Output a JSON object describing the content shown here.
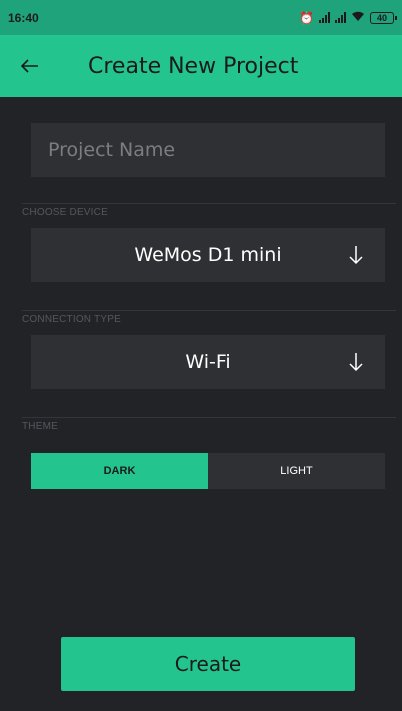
{
  "status_bar": {
    "time": "16:40",
    "battery": "40"
  },
  "app_bar": {
    "title": "Create New Project",
    "back_icon": "arrow-left-icon"
  },
  "project_name": {
    "value": "",
    "placeholder": "Project Name"
  },
  "device": {
    "section_label": "CHOOSE DEVICE",
    "value": "WeMos D1 mini"
  },
  "connection": {
    "section_label": "CONNECTION TYPE",
    "value": "Wi-Fi"
  },
  "theme": {
    "section_label": "THEME",
    "options": [
      "DARK",
      "LIGHT"
    ],
    "selected": "DARK"
  },
  "create_button": "Create",
  "colors": {
    "accent": "#23c48e",
    "background": "#222327",
    "field": "#2f3034"
  }
}
